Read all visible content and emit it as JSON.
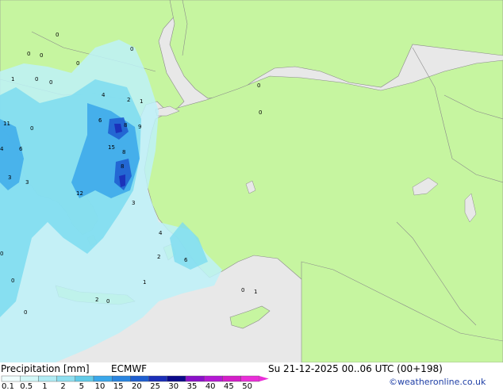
{
  "map": {
    "colors": {
      "sea": "#e8e8e8",
      "land": "#c6f5a0",
      "border": "#8a8a8a",
      "precip_light": "#bdf1f8",
      "precip_mid": "#7ddcf0",
      "precip_med": "#3aa7ea",
      "precip_heavy": "#1f5fd0",
      "precip_vheavy": "#1b2fb8"
    },
    "point_values": [
      "0",
      "1",
      "4",
      "6",
      "8",
      "9",
      "11",
      "12",
      "15",
      "2",
      "3",
      "5"
    ]
  },
  "footer": {
    "title": "Precipitation [mm]",
    "model": "ECMWF",
    "datetime": "Su 21-12-2025 00..06 UTC (00+198)",
    "credit": "©weatheronline.co.uk"
  },
  "legend": {
    "ticks": [
      "0.1",
      "0.5",
      "1",
      "2",
      "5",
      "10",
      "15",
      "20",
      "25",
      "30",
      "35",
      "40",
      "45",
      "50"
    ],
    "colors": [
      "#f0fdfd",
      "#d2f7f7",
      "#b0ecf4",
      "#8fdff0",
      "#63cbe8",
      "#3aa7ea",
      "#2a85e0",
      "#1f5fd0",
      "#1b2fb8",
      "#0b0a8a",
      "#8a10c8",
      "#b418d4",
      "#d41ec8",
      "#ea2ed8"
    ]
  }
}
